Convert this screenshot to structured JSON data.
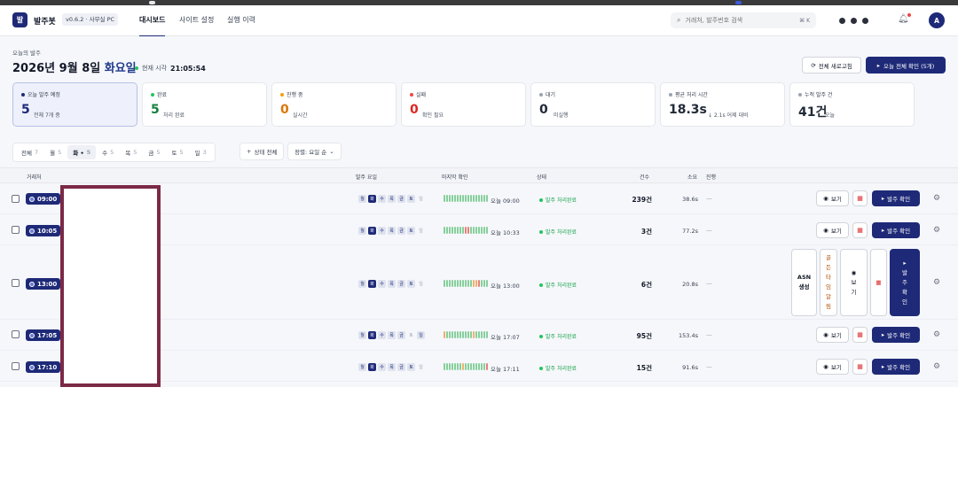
{
  "app": {
    "logo_char": "발",
    "name": "발주봇",
    "version": "v0.6.2 · 사무실 PC"
  },
  "nav": {
    "tabs": [
      "대시보드",
      "사이트 설정",
      "실행 이력"
    ]
  },
  "search": {
    "placeholder": "거래처, 발주번호 검색",
    "shortcut": "⌘ K"
  },
  "user": {
    "initial": "A"
  },
  "header": {
    "eyebrow": "오늘의 발주",
    "date": "2026년 9월 8일",
    "weekday": "화요일",
    "clock_label": "현재 시각",
    "clock_value": "21:05:54",
    "refresh_label": "전체 새로고침",
    "confirm_all_label": "오늘 전체 확인 (5개)"
  },
  "stats": [
    {
      "label": "오늘 발주 예정",
      "value": "5",
      "sub": "전체 7개 중",
      "color": "#1e2a78",
      "value_color": "#1e2a78"
    },
    {
      "label": "완료",
      "value": "5",
      "sub": "처리 완료",
      "color": "#22c55e",
      "value_color": "#15803d"
    },
    {
      "label": "진행 중",
      "value": "0",
      "sub": "실시간",
      "color": "#f59e0b",
      "value_color": "#d97706"
    },
    {
      "label": "실패",
      "value": "0",
      "sub": "확인 필요",
      "color": "#ef4444",
      "value_color": "#dc2626"
    },
    {
      "label": "대기",
      "value": "0",
      "sub": "미실행",
      "color": "#9ca3af",
      "value_color": "#111827"
    },
    {
      "label": "평균 처리 시간",
      "value": "18.3s",
      "sub": "↓ 2.1s 어제 대비",
      "color": "#9ca3af",
      "value_color": "#111827"
    },
    {
      "label": "누적 발주 건",
      "value": "41건",
      "sub": "오늘",
      "color": "#9ca3af",
      "value_color": "#111827"
    }
  ],
  "filters": {
    "days": [
      {
        "label": "전체",
        "count": "7"
      },
      {
        "label": "월",
        "count": "5"
      },
      {
        "label": "화 •",
        "count": "5"
      },
      {
        "label": "수",
        "count": "5"
      },
      {
        "label": "목",
        "count": "5"
      },
      {
        "label": "금",
        "count": "5"
      },
      {
        "label": "토",
        "count": "5"
      },
      {
        "label": "일",
        "count": "3"
      }
    ],
    "status_label": "상태 전체",
    "sort_label": "정렬: 요일 순"
  },
  "table": {
    "columns": [
      "거래처",
      "발주 요일",
      "마지막 확인",
      "상태",
      "건수",
      "소요",
      "진행"
    ],
    "weekday_chips": [
      "월",
      "화",
      "수",
      "목",
      "금",
      "토",
      "일"
    ],
    "rows": [
      {
        "time": "09:00",
        "last": "오늘 09:00",
        "status": "발주 처리완료",
        "count": "239건",
        "duration": "38.6s",
        "progress": "—",
        "chip_states": [
          "a",
          "on",
          "a",
          "a",
          "a",
          "a",
          "off"
        ],
        "bar_colors": "ggggggggggggggggg"
      },
      {
        "time": "10:05",
        "last": "오늘 10:33",
        "status": "발주 처리완료",
        "count": "3건",
        "duration": "77.2s",
        "progress": "—",
        "chip_states": [
          "a",
          "on",
          "a",
          "a",
          "a",
          "a",
          "off"
        ],
        "bar_colors": "ggggggggrrggggggg"
      },
      {
        "time": "13:00",
        "last": "오늘 13:00",
        "status": "발주 처리완료",
        "count": "6건",
        "duration": "20.8s",
        "progress": "—",
        "chip_states": [
          "a",
          "on",
          "a",
          "a",
          "a",
          "a",
          "off"
        ],
        "bar_colors": "gggggggggggoorggg"
      },
      {
        "time": "17:05",
        "last": "오늘 17:07",
        "status": "발주 처리완료",
        "count": "95건",
        "duration": "153.4s",
        "progress": "—",
        "chip_states": [
          "a",
          "on",
          "a",
          "a",
          "a",
          "off",
          "a"
        ],
        "bar_colors": "oggggggggggoggggg"
      },
      {
        "time": "17:10",
        "last": "오늘 17:11",
        "status": "발주 처리완료",
        "count": "15건",
        "duration": "91.6s",
        "progress": "—",
        "chip_states": [
          "a",
          "on",
          "a",
          "a",
          "a",
          "a",
          "off"
        ],
        "bar_colors": "gggggggoggggggggr"
      }
    ]
  },
  "actions": {
    "view": "보기",
    "confirm": "발주 확인",
    "asn": "ASN 생성",
    "golden": "골든타임 알림"
  }
}
